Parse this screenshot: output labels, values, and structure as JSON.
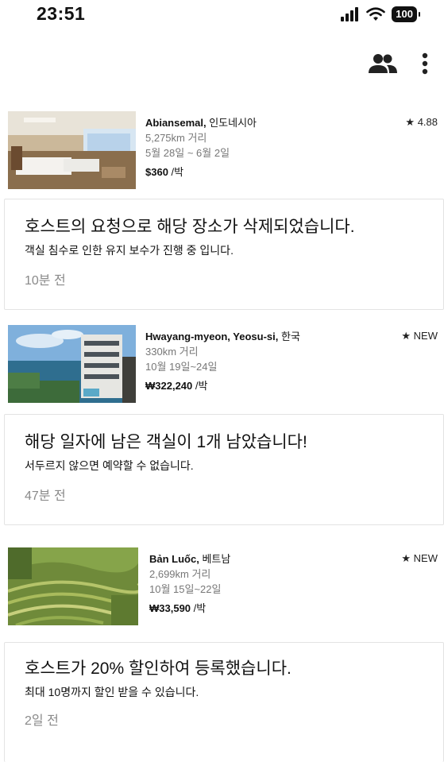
{
  "status": {
    "time": "23:51",
    "battery": "100"
  },
  "header": {
    "icons": [
      "people-icon",
      "more-vertical-icon"
    ]
  },
  "listings": [
    {
      "location_name": "Abiansemal,",
      "location_country": " 인도네시아",
      "distance": "5,275km 거리",
      "dates": "5월 28일 ~ 6월 2일",
      "price": "$360",
      "per_night": " /박",
      "rating": "★ 4.88"
    },
    {
      "location_name": "Hwayang-myeon, Yeosu-si,",
      "location_country": " 한국",
      "distance": "330km 거리",
      "dates": "10월 19일~24일",
      "price": "₩322,240",
      "per_night": " /박",
      "rating": "★ NEW"
    },
    {
      "location_name": "Bản Luốc,",
      "location_country": " 베트남",
      "distance": "2,699km 거리",
      "dates": "10월 15일~22일",
      "price": "₩33,590",
      "per_night": " /박",
      "rating": "★ NEW"
    }
  ],
  "notifications": [
    {
      "title": "호스트의 요청으로 해당 장소가 삭제되었습니다.",
      "body": "객실 침수로 인한 유지 보수가 진행 중 입니다.",
      "time": "10분 전"
    },
    {
      "title": "해당 일자에 남은 객실이 1개 남았습니다!",
      "body": "서두르지 않으면 예약할 수 없습니다.",
      "time": "47분 전"
    },
    {
      "title": "호스트가 20% 할인하여 등록했습니다.",
      "body": "최대 10명까지 할인 받을 수 있습니다.",
      "time": "2일 전"
    }
  ]
}
